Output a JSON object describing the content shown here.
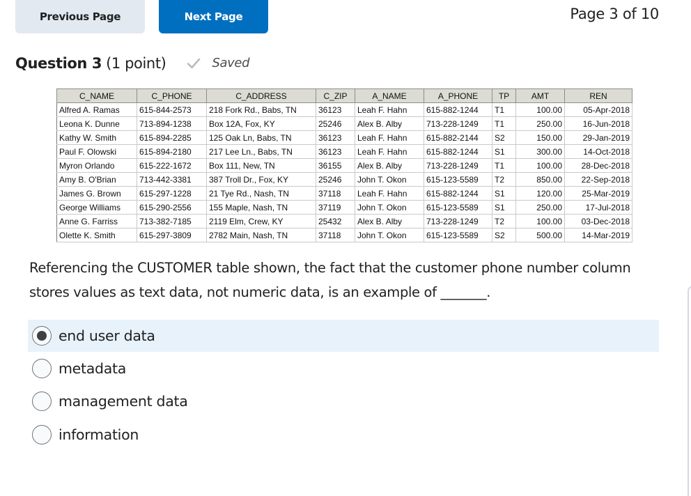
{
  "nav": {
    "previous_label": "Previous Page",
    "next_label": "Next Page",
    "page_indicator": "Page 3 of 10",
    "accent_color": "#006fbf"
  },
  "question": {
    "title": "Question 3",
    "points": "(1 point)",
    "status_icon": "check-icon",
    "status": "Saved",
    "text": "Referencing the CUSTOMER table shown, the fact that the customer phone number column stores values as text data, not numeric data, is an example of _______."
  },
  "table": {
    "columns": [
      "C_NAME",
      "C_PHONE",
      "C_ADDRESS",
      "C_ZIP",
      "A_NAME",
      "A_PHONE",
      "TP",
      "AMT",
      "REN"
    ],
    "rows": [
      [
        "Alfred A. Ramas",
        "615-844-2573",
        "218 Fork Rd., Babs, TN",
        "36123",
        "Leah F. Hahn",
        "615-882-1244",
        "T1",
        "100.00",
        "05-Apr-2018"
      ],
      [
        "Leona K. Dunne",
        "713-894-1238",
        "Box 12A, Fox, KY",
        "25246",
        "Alex B. Alby",
        "713-228-1249",
        "T1",
        "250.00",
        "16-Jun-2018"
      ],
      [
        "Kathy W. Smith",
        "615-894-2285",
        "125 Oak Ln, Babs, TN",
        "36123",
        "Leah F. Hahn",
        "615-882-2144",
        "S2",
        "150.00",
        "29-Jan-2019"
      ],
      [
        "Paul F. Olowski",
        "615-894-2180",
        "217 Lee Ln., Babs, TN",
        "36123",
        "Leah F. Hahn",
        "615-882-1244",
        "S1",
        "300.00",
        "14-Oct-2018"
      ],
      [
        "Myron Orlando",
        "615-222-1672",
        "Box 111, New, TN",
        "36155",
        "Alex B. Alby",
        "713-228-1249",
        "T1",
        "100.00",
        "28-Dec-2018"
      ],
      [
        "Amy B. O'Brian",
        "713-442-3381",
        "387 Troll Dr., Fox, KY",
        "25246",
        "John T. Okon",
        "615-123-5589",
        "T2",
        "850.00",
        "22-Sep-2018"
      ],
      [
        "James G. Brown",
        "615-297-1228",
        "21 Tye Rd., Nash, TN",
        "37118",
        "Leah F. Hahn",
        "615-882-1244",
        "S1",
        "120.00",
        "25-Mar-2019"
      ],
      [
        "George Williams",
        "615-290-2556",
        "155 Maple, Nash, TN",
        "37119",
        "John T. Okon",
        "615-123-5589",
        "S1",
        "250.00",
        "17-Jul-2018"
      ],
      [
        "Anne G. Farriss",
        "713-382-7185",
        "2119 Elm, Crew, KY",
        "25432",
        "Alex B. Alby",
        "713-228-1249",
        "T2",
        "100.00",
        "03-Dec-2018"
      ],
      [
        "Olette K. Smith",
        "615-297-3809",
        "2782 Main, Nash, TN",
        "37118",
        "John T. Okon",
        "615-123-5589",
        "S2",
        "500.00",
        "14-Mar-2019"
      ]
    ]
  },
  "options": [
    {
      "label": "end user data",
      "selected": true
    },
    {
      "label": "metadata",
      "selected": false
    },
    {
      "label": "management data",
      "selected": false
    },
    {
      "label": "information",
      "selected": false
    }
  ]
}
